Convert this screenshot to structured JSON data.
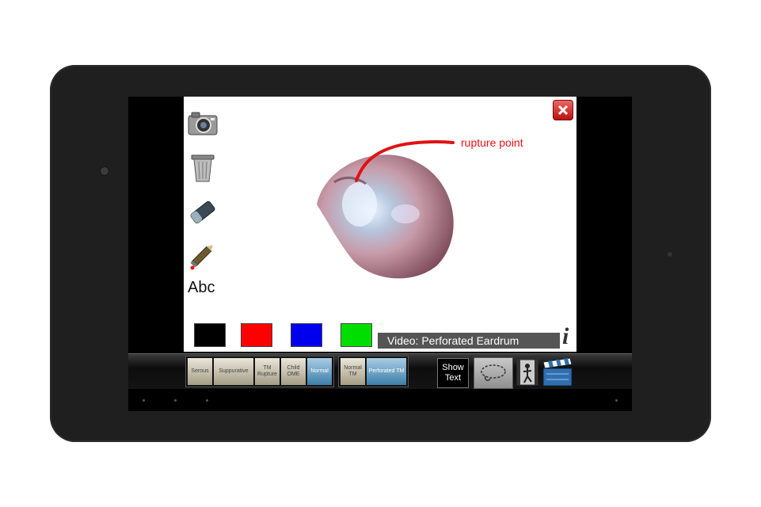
{
  "canvas": {
    "tools": {
      "camera": "camera-icon",
      "trash": "trash-icon",
      "eraser": "eraser-icon",
      "pencil": "pencil-icon",
      "text_tool": "Abc"
    },
    "annotation_text": "rupture point",
    "annotation_color": "#e11111",
    "swatches": [
      "#000000",
      "#ff0000",
      "#0000ee",
      "#00dd00"
    ],
    "caption": "Video: Perforated Eardrum",
    "info_symbol": "i"
  },
  "toolbar": {
    "group1": [
      {
        "label": "Serous",
        "active": false
      },
      {
        "label": "Suppurative",
        "active": false
      },
      {
        "label": "TM Rupture",
        "active": false
      },
      {
        "label": "Child OME",
        "active": false
      },
      {
        "label": "Normal",
        "active": true
      }
    ],
    "group2": [
      {
        "label": "Normal TM",
        "active": false
      },
      {
        "label": "Perforated TM",
        "active": true
      }
    ],
    "show_text": "Show Text"
  }
}
